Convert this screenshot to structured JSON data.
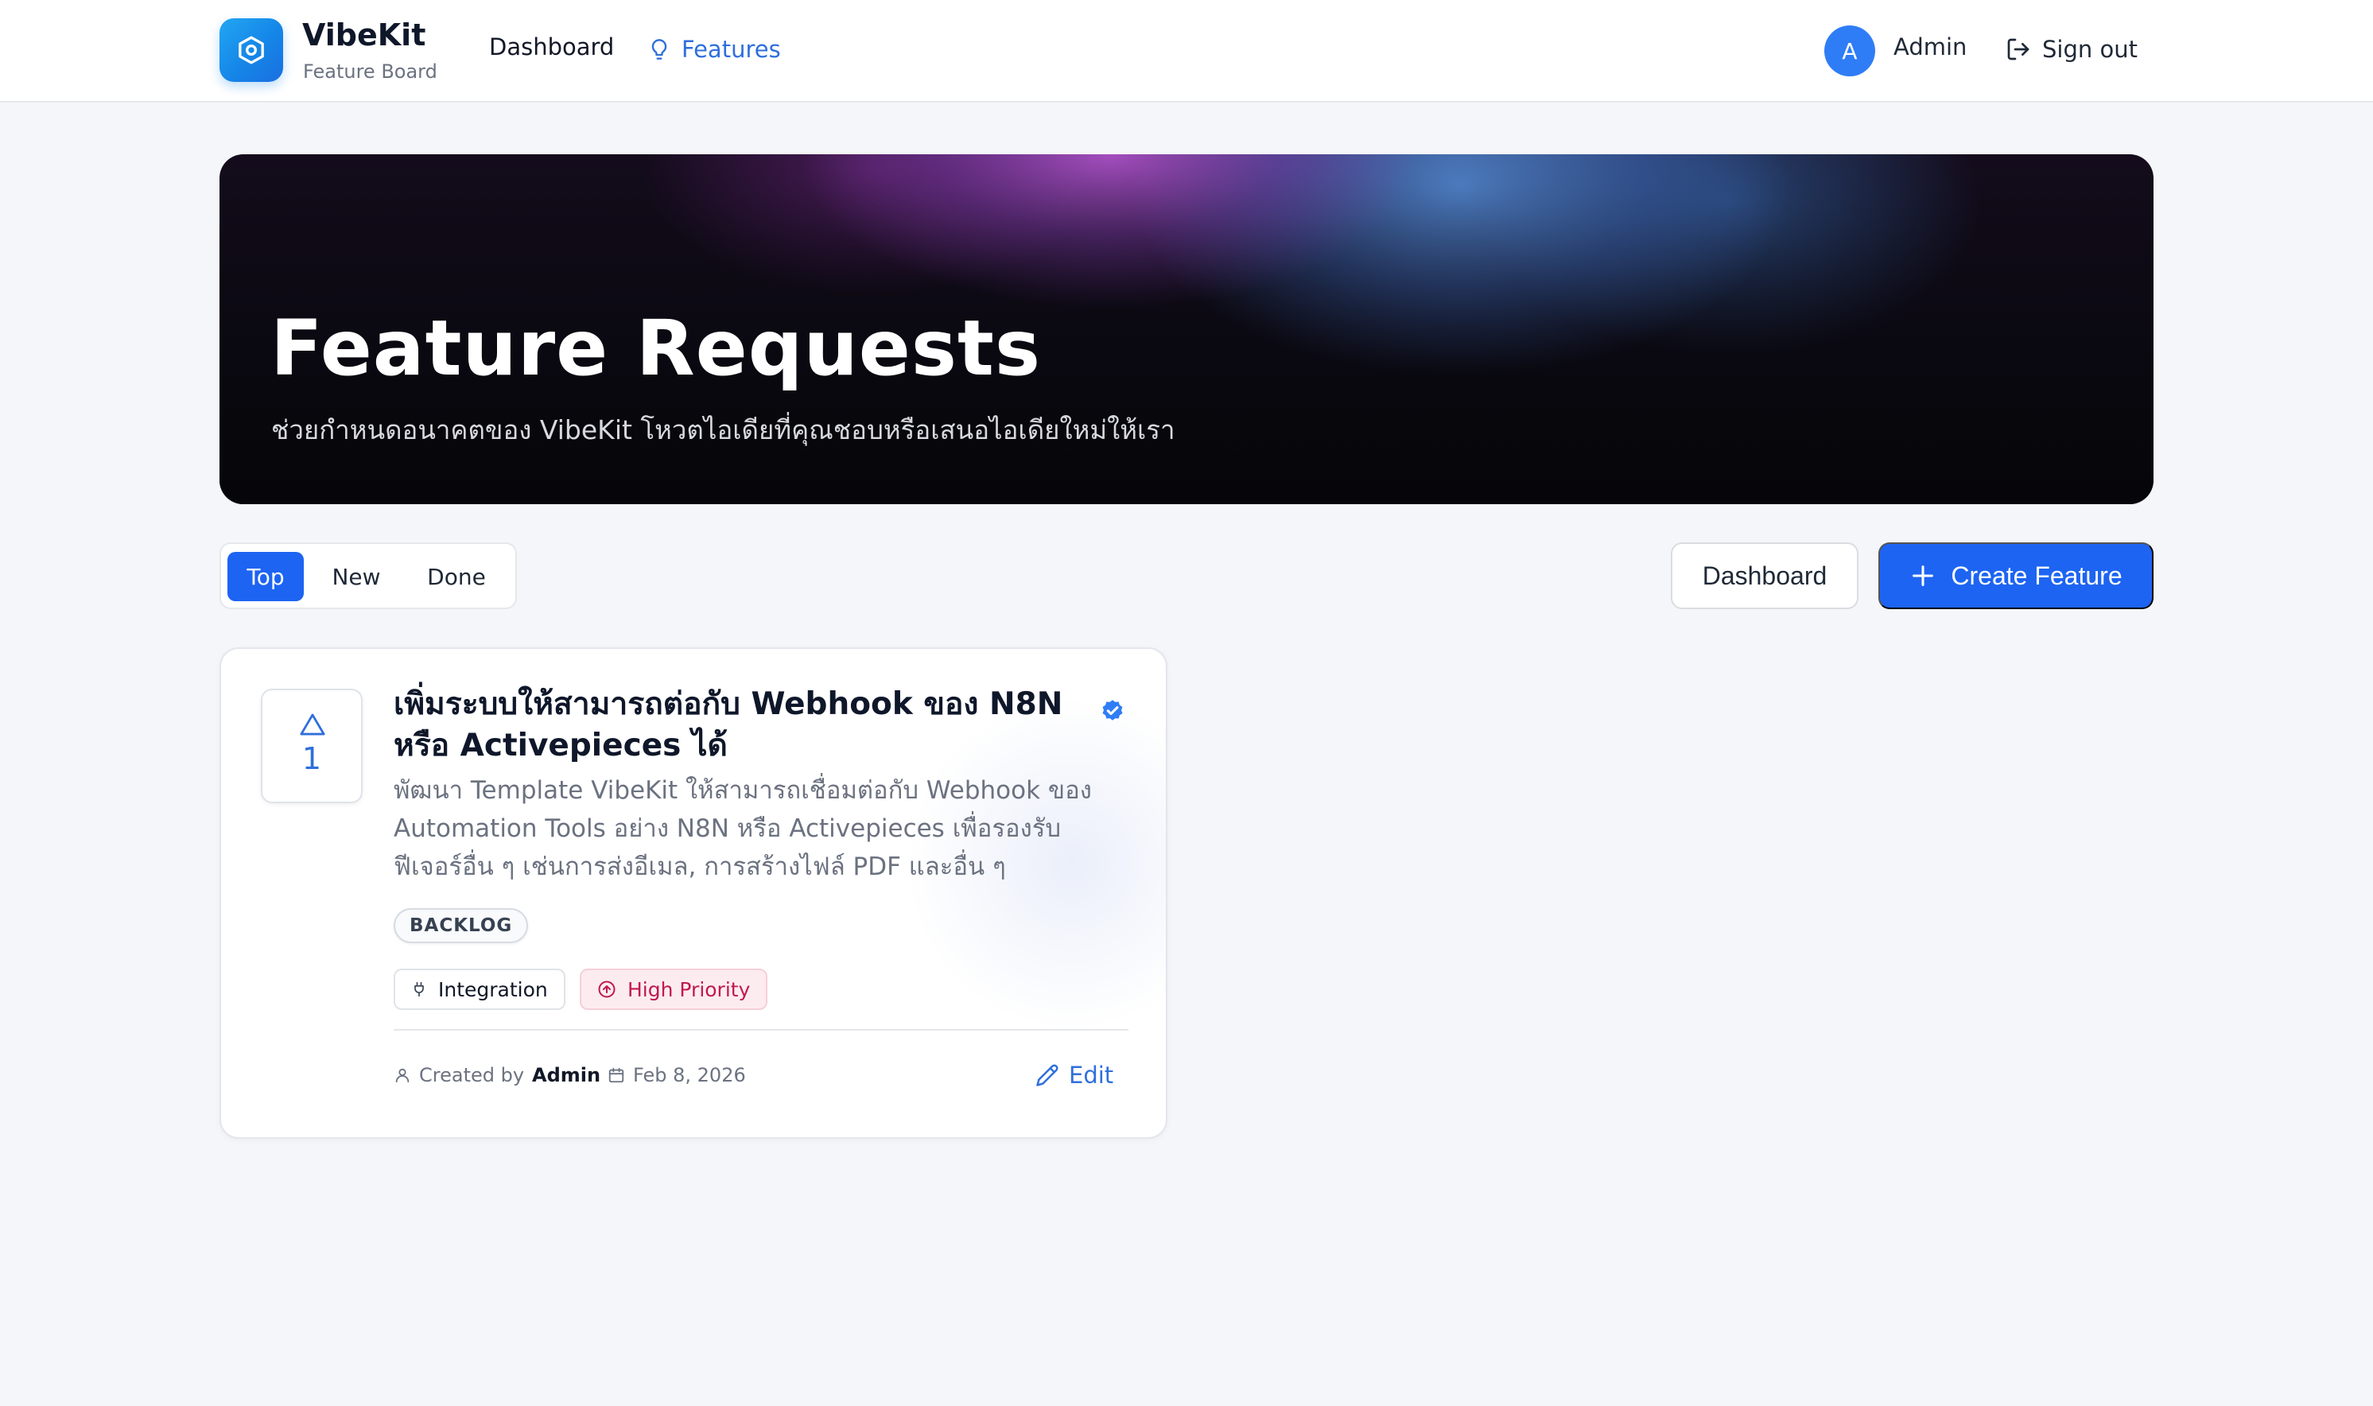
{
  "header": {
    "brand": {
      "name": "VibeKit",
      "subtitle": "Feature Board"
    },
    "nav": {
      "dashboard": "Dashboard",
      "features": "Features"
    },
    "user": {
      "initial": "A",
      "name": "Admin"
    },
    "signout": "Sign out"
  },
  "hero": {
    "title": "Feature Requests",
    "subtitle": "ช่วยกำหนดอนาคตของ VibeKit โหวตไอเดียที่คุณชอบหรือเสนอไอเดียใหม่ให้เรา"
  },
  "toolbar": {
    "sort_tabs": [
      {
        "label": "Top",
        "active": true
      },
      {
        "label": "New",
        "active": false
      },
      {
        "label": "Done",
        "active": false
      }
    ],
    "dashboard_button": "Dashboard",
    "create_button": "Create Feature"
  },
  "features": [
    {
      "votes": "1",
      "title": "เพิ่มระบบให้สามารถต่อกับ Webhook ของ N8N หรือ Activepieces ได้",
      "description": "พัฒนา Template VibeKit ให้สามารถเชื่อมต่อกับ Webhook ของ Automation Tools อย่าง N8N หรือ Activepieces เพื่อรองรับฟีเจอร์อื่น ๆ เช่นการส่งอีเมล, การสร้างไฟล์ PDF และอื่น ๆ",
      "status": "BACKLOG",
      "tags": [
        {
          "label": "Integration",
          "icon": "plug-icon"
        },
        {
          "label": "High Priority",
          "icon": "arrow-up-circle-icon"
        }
      ],
      "created_by_prefix": "Created by",
      "created_by": "Admin",
      "date": "Feb 8, 2026",
      "edit_label": "Edit",
      "verified": true
    }
  ],
  "colors": {
    "primary": "#1d64f2",
    "link": "#2f6fdc",
    "priority_text": "#c0194f",
    "priority_bg": "#fdecef",
    "avatar": "#2f7df6",
    "page_bg": "#f5f6f9"
  },
  "icons": {
    "logo": "hexagon-icon",
    "features": "lightbulb-icon",
    "signout": "log-out-icon",
    "create": "plus-icon",
    "vote": "triangle-up-icon",
    "verified": "check-badge-icon",
    "author": "user-icon",
    "date": "calendar-icon",
    "edit": "pencil-icon"
  }
}
